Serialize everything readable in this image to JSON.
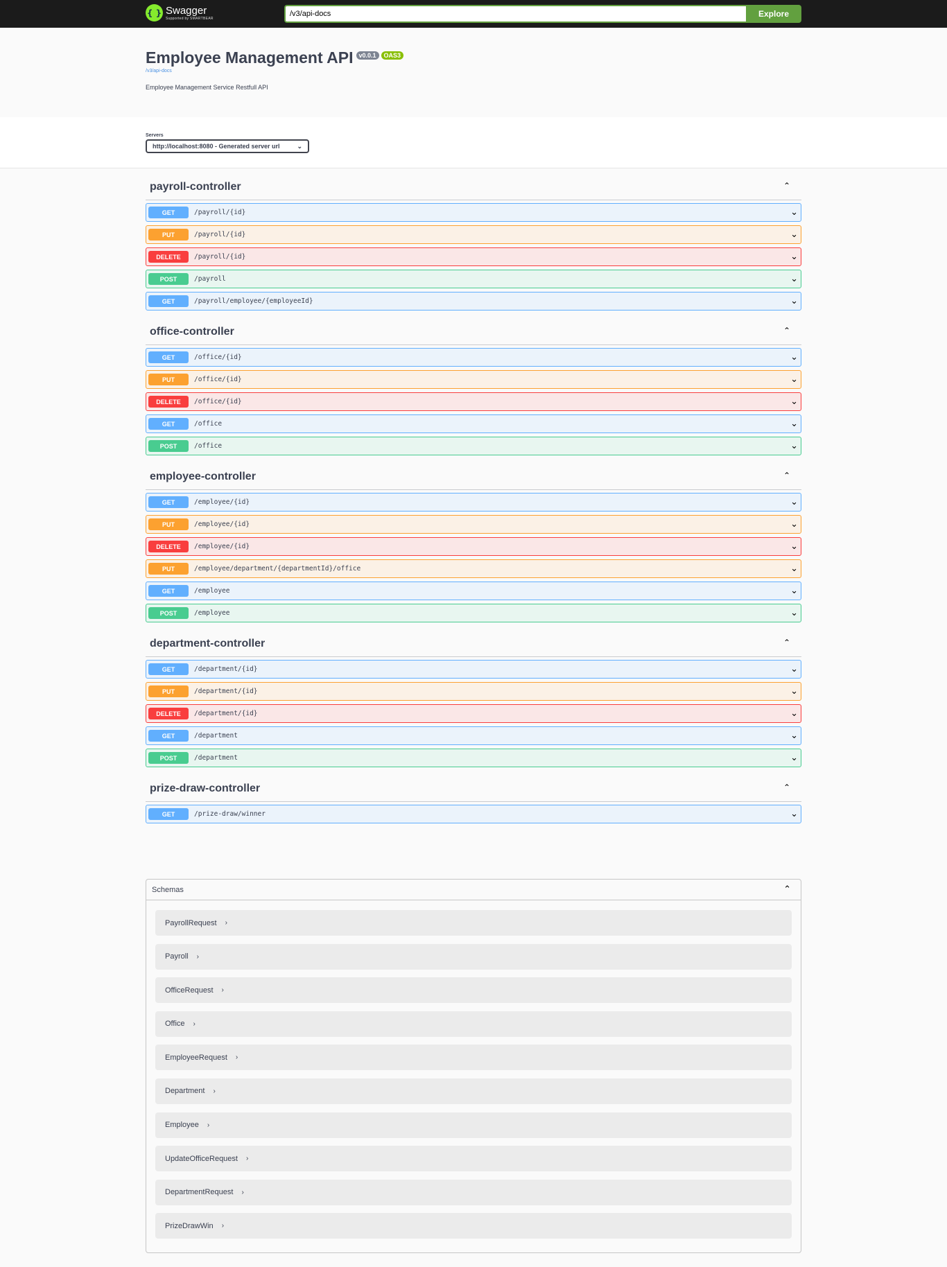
{
  "topbar": {
    "logo_title": "Swagger",
    "logo_sub": "Supported by SMARTBEAR",
    "url_value": "/v3/api-docs",
    "explore_label": "Explore"
  },
  "info": {
    "title": "Employee Management API",
    "version": "v0.0.1",
    "oas": "OAS3",
    "spec_link": "/v3/api-docs",
    "description": "Employee Management Service Restfull API"
  },
  "servers": {
    "label": "Servers",
    "selected": "http://localhost:8080 - Generated server url"
  },
  "tags": [
    {
      "name": "payroll-controller",
      "ops": [
        {
          "method": "GET",
          "path": "/payroll/{id}"
        },
        {
          "method": "PUT",
          "path": "/payroll/{id}"
        },
        {
          "method": "DELETE",
          "path": "/payroll/{id}"
        },
        {
          "method": "POST",
          "path": "/payroll"
        },
        {
          "method": "GET",
          "path": "/payroll/employee/{employeeId}"
        }
      ]
    },
    {
      "name": "office-controller",
      "ops": [
        {
          "method": "GET",
          "path": "/office/{id}"
        },
        {
          "method": "PUT",
          "path": "/office/{id}"
        },
        {
          "method": "DELETE",
          "path": "/office/{id}"
        },
        {
          "method": "GET",
          "path": "/office"
        },
        {
          "method": "POST",
          "path": "/office"
        }
      ]
    },
    {
      "name": "employee-controller",
      "ops": [
        {
          "method": "GET",
          "path": "/employee/{id}"
        },
        {
          "method": "PUT",
          "path": "/employee/{id}"
        },
        {
          "method": "DELETE",
          "path": "/employee/{id}"
        },
        {
          "method": "PUT",
          "path": "/employee/department/{departmentId}/office"
        },
        {
          "method": "GET",
          "path": "/employee"
        },
        {
          "method": "POST",
          "path": "/employee"
        }
      ]
    },
    {
      "name": "department-controller",
      "ops": [
        {
          "method": "GET",
          "path": "/department/{id}"
        },
        {
          "method": "PUT",
          "path": "/department/{id}"
        },
        {
          "method": "DELETE",
          "path": "/department/{id}"
        },
        {
          "method": "GET",
          "path": "/department"
        },
        {
          "method": "POST",
          "path": "/department"
        }
      ]
    },
    {
      "name": "prize-draw-controller",
      "ops": [
        {
          "method": "GET",
          "path": "/prize-draw/winner"
        }
      ]
    }
  ],
  "schemas": {
    "title": "Schemas",
    "items": [
      "PayrollRequest",
      "Payroll",
      "OfficeRequest",
      "Office",
      "EmployeeRequest",
      "Department",
      "Employee",
      "UpdateOfficeRequest",
      "DepartmentRequest",
      "PrizeDrawWin"
    ]
  },
  "colors": {
    "get": "#61affe",
    "put": "#fca130",
    "delete": "#f93e3e",
    "post": "#49cc90",
    "explore": "#62a03f"
  }
}
